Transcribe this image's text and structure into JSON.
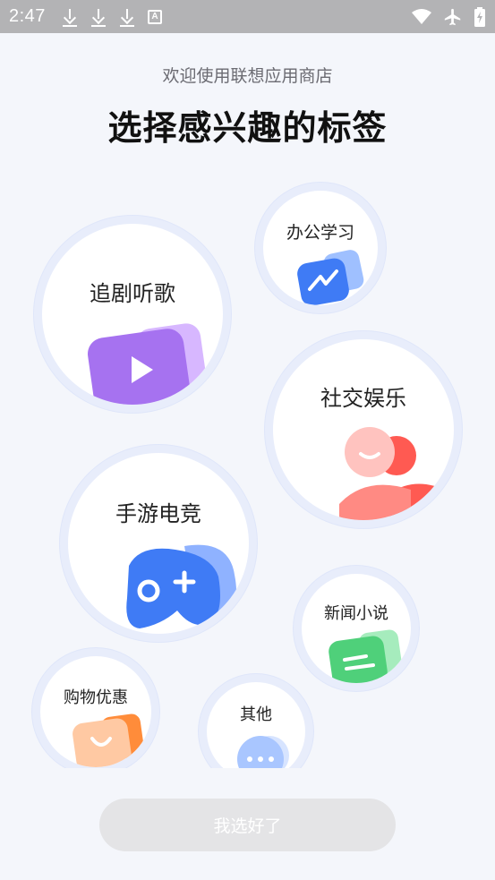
{
  "status_bar": {
    "time": "2:47"
  },
  "header": {
    "welcome": "欢迎使用联想应用商店",
    "title": "选择感兴趣的标签"
  },
  "tags": {
    "office": "办公学习",
    "drama": "追剧听歌",
    "social": "社交娱乐",
    "games": "手游电竞",
    "news": "新闻小说",
    "shopping": "购物优惠",
    "other": "其他"
  },
  "footer": {
    "done_label": "我选好了"
  },
  "colors": {
    "accent_purple": "#a672f0",
    "accent_blue": "#3f7bf5",
    "accent_red": "#ff5a52",
    "accent_green": "#4fd07a",
    "accent_orange": "#ff8c3a",
    "bubble_ring": "#e8edfb"
  }
}
